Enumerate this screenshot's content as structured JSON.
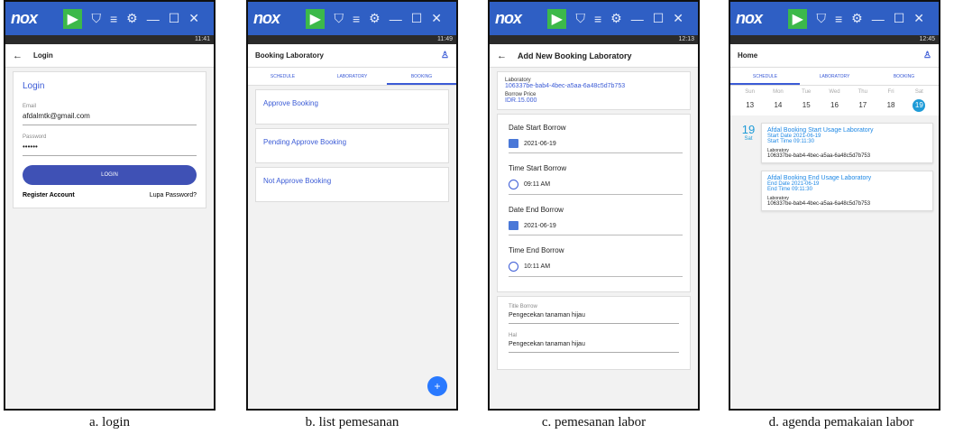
{
  "emulator": {
    "brand": "nox"
  },
  "screens": {
    "login": {
      "time": "11:41",
      "title": "Login",
      "heading": "Login",
      "email_label": "Email",
      "email_value": "afdalmtk@gmail.com",
      "password_label": "Password",
      "password_value": "••••••",
      "login_button": "LOGIN",
      "register": "Register Account",
      "forgot": "Lupa Password?",
      "caption": "a. login"
    },
    "list": {
      "time": "11:49",
      "title": "Booking Laboratory",
      "tabs": [
        "SCHEDULE",
        "LABORATORY",
        "BOOKING"
      ],
      "items": [
        "Approve Booking",
        "Pending Approve Booking",
        "Not Approve Booking"
      ],
      "fab": "+",
      "caption": "b. list pemesanan"
    },
    "booking": {
      "time": "12:13",
      "title": "Add New Booking Laboratory",
      "lab_label": "Laboratory",
      "lab_value": "106337be-bab4-4bec-a5aa-6a48c5d7b753",
      "price_label": "Borrow Price",
      "price_value": "IDR.15.000",
      "date_start_label": "Date Start Borrow",
      "date_start": "2021-06-19",
      "time_start_label": "Time Start Borrow",
      "time_start": "09:11 AM",
      "date_end_label": "Date End Borrow",
      "date_end": "2021-06-19",
      "time_end_label": "Time End Borrow",
      "time_end": "10:11 AM",
      "title_borrow_label": "Title Borrow",
      "title_borrow": "Pengecekan tanaman hijau",
      "hal_label": "Hal",
      "hal": "Pengecekan tanaman hijau",
      "caption": "c. pemesanan labor"
    },
    "agenda": {
      "time": "12:45",
      "title": "Home",
      "tabs": [
        "SCHEDULE",
        "LABORATORY",
        "BOOKING"
      ],
      "days": [
        {
          "name": "Sun",
          "num": "13"
        },
        {
          "name": "Mon",
          "num": "14"
        },
        {
          "name": "Tue",
          "num": "15"
        },
        {
          "name": "Wed",
          "num": "16"
        },
        {
          "name": "Thu",
          "num": "17"
        },
        {
          "name": "Fri",
          "num": "18"
        },
        {
          "name": "Sat",
          "num": "19"
        }
      ],
      "date_num": "19",
      "date_day": "Sat",
      "events": [
        {
          "title": "Afdal Booking Start Usage Laboratory",
          "line1": "Start Date 2021-06-19",
          "line2": "Start Time 09:11:30",
          "lab_label": "Laboratory",
          "lab": "106337be-bab4-4bec-a5aa-6a48c5d7b753"
        },
        {
          "title": "Afdal Booking End Usage Laboratory",
          "line1": "End Date 2021-06-19",
          "line2": "End Time 09:11:30",
          "lab_label": "Laboratory",
          "lab": "106337be-bab4-4bec-a5aa-6a48c5d7b753"
        }
      ],
      "caption": "d. agenda pemakaian labor"
    }
  }
}
